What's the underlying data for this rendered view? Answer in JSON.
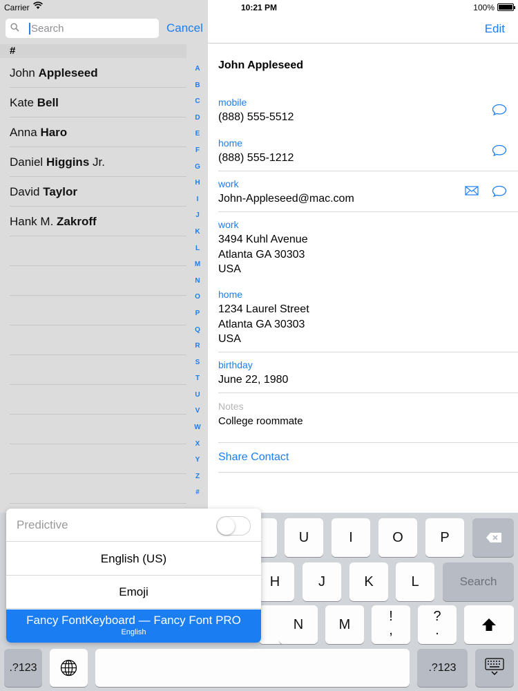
{
  "status": {
    "carrier": "Carrier",
    "time": "10:21 PM",
    "battery": "100%"
  },
  "search": {
    "placeholder": "Search",
    "cancel_label": "Cancel"
  },
  "list": {
    "section_header": "#",
    "contacts": [
      {
        "first": "John",
        "last": "Appleseed",
        "suffix": ""
      },
      {
        "first": "Kate",
        "last": "Bell",
        "suffix": ""
      },
      {
        "first": "Anna",
        "last": "Haro",
        "suffix": ""
      },
      {
        "first": "Daniel",
        "last": "Higgins",
        "suffix": " Jr."
      },
      {
        "first": "David",
        "last": "Taylor",
        "suffix": ""
      },
      {
        "first": "Hank M.",
        "last": "Zakroff",
        "suffix": ""
      }
    ],
    "index": [
      "A",
      "B",
      "C",
      "D",
      "E",
      "F",
      "G",
      "H",
      "I",
      "J",
      "K",
      "L",
      "M",
      "N",
      "O",
      "P",
      "Q",
      "R",
      "S",
      "T",
      "U",
      "V",
      "W",
      "X",
      "Y",
      "Z",
      "#"
    ]
  },
  "detail": {
    "edit_label": "Edit",
    "name": "John Appleseed",
    "mobile": {
      "label": "mobile",
      "value": "(888) 555-5512"
    },
    "home_phone": {
      "label": "home",
      "value": "(888) 555-1212"
    },
    "work_email": {
      "label": "work",
      "value": "John-Appleseed@mac.com"
    },
    "work_address": {
      "label": "work",
      "line1": "3494 Kuhl Avenue",
      "line2": "Atlanta GA 30303",
      "line3": "USA"
    },
    "home_address": {
      "label": "home",
      "line1": "1234 Laurel Street",
      "line2": "Atlanta GA 30303",
      "line3": "USA"
    },
    "birthday": {
      "label": "birthday",
      "value": "June 22, 1980"
    },
    "notes": {
      "label": "Notes",
      "value": "College roommate"
    },
    "share_label": "Share Contact"
  },
  "keyboard": {
    "row1": [
      "U",
      "I",
      "O",
      "P"
    ],
    "row2": [
      "H",
      "J",
      "K",
      "L"
    ],
    "search_key": "Search",
    "row3": [
      "N",
      "M"
    ],
    "excl_top": "!",
    "excl_bottom": ",",
    "quest_top": "?",
    "quest_bottom": ".",
    "numbers_left": ".?123",
    "numbers_right": ".?123"
  },
  "popup": {
    "predictive_label": "Predictive",
    "predictive_on": false,
    "items": [
      "English (US)",
      "Emoji"
    ],
    "selected_title": "Fancy FontKeyboard — Fancy Font PRO",
    "selected_subtitle": "English"
  },
  "colors": {
    "accent": "#1a7ef2",
    "sidebar_bg": "#dcdcdc",
    "keyboard_bg": "#d1d4d9"
  }
}
